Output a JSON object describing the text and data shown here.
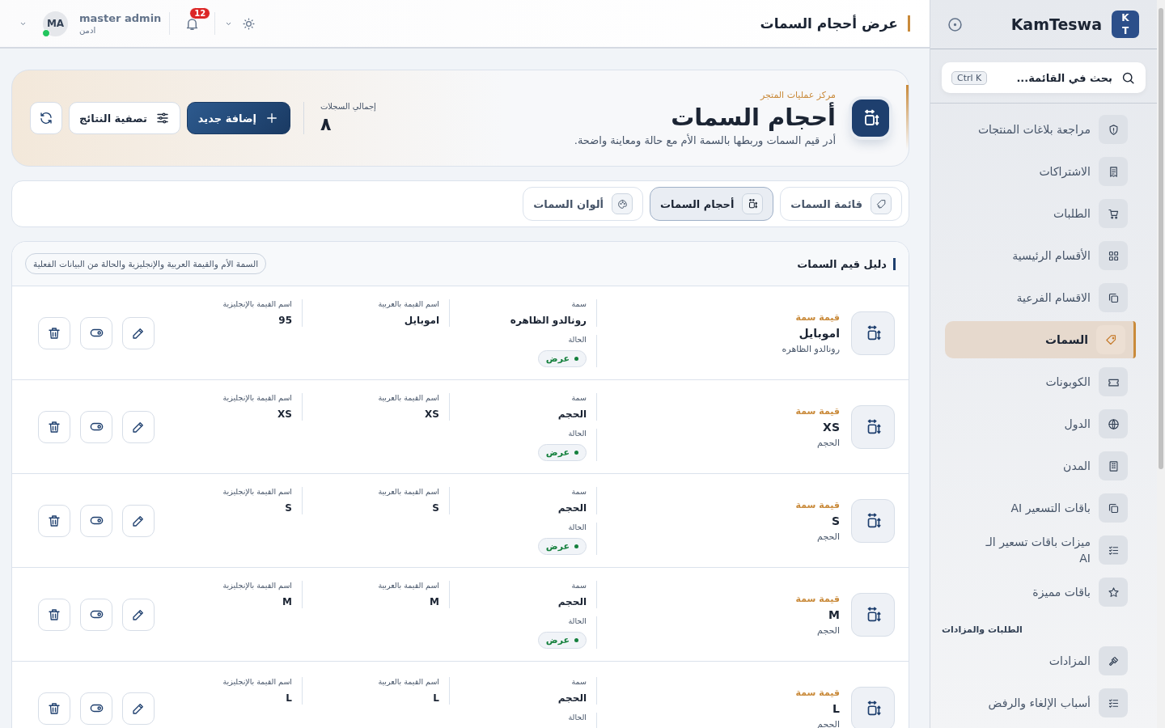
{
  "topbar": {
    "title": "عرض أحجام السمات",
    "notifications": "12",
    "user": {
      "name": "master admin",
      "role": "ادمن",
      "initials": "MA",
      "online": true
    }
  },
  "sidebar": {
    "brand": "KamTeswa",
    "logo": [
      "K",
      "T"
    ],
    "search": {
      "placeholder": "بحث في القائمة...",
      "shortcut": "Ctrl K"
    },
    "items": [
      {
        "kind": "item",
        "label": "مراجعة بلاغات المنتجات",
        "selected": false
      },
      {
        "kind": "item",
        "label": "الاشتراكات",
        "selected": false
      },
      {
        "kind": "item",
        "label": "الطلبات",
        "selected": false
      },
      {
        "kind": "item",
        "label": "الأقسام الرئيسية",
        "selected": false
      },
      {
        "kind": "item",
        "label": "الاقسام الفرعية",
        "selected": false
      },
      {
        "kind": "item",
        "label": "السمات",
        "selected": true
      },
      {
        "kind": "item",
        "label": "الكوبونات",
        "selected": false
      },
      {
        "kind": "item",
        "label": "الدول",
        "selected": false
      },
      {
        "kind": "item",
        "label": "المدن",
        "selected": false
      },
      {
        "kind": "item",
        "label": "باقات التسعير AI",
        "selected": false
      },
      {
        "kind": "item",
        "label": "ميزات باقات تسعير الـ AI",
        "selected": false
      },
      {
        "kind": "item",
        "label": "باقات مميزة",
        "selected": false
      },
      {
        "kind": "section",
        "label": "الطلبات والمزادات"
      },
      {
        "kind": "item",
        "label": "المزادات",
        "selected": false
      },
      {
        "kind": "item",
        "label": "أسباب الإلغاء والرفض",
        "selected": false
      }
    ]
  },
  "hero": {
    "kicker": "مركز عمليات المتجر",
    "title": "أحجام السمات",
    "description": "أدر قيم السمات وربطها بالسمة الأم مع حالة ومعاينة واضحة.",
    "stat_label": "إجمالي السجلات",
    "stat_value": "٨",
    "buttons": [
      {
        "kind": "primary",
        "label": "إضافة جديد"
      },
      {
        "kind": "filter",
        "label": "تصفية النتائج"
      },
      {
        "kind": "refresh"
      }
    ]
  },
  "tabs": [
    {
      "label": "قائمة السمات",
      "selected": false
    },
    {
      "label": "أحجام السمات",
      "selected": true
    },
    {
      "label": "ألوان السمات",
      "selected": false
    }
  ],
  "list": {
    "title": "دليل قيم السمات",
    "hint": "السمة الأم والقيمة العربية والإنجليزية والحالة من البيانات الفعلية",
    "rows": [
      {
        "kicker": "قيمة سمة",
        "title": "اموبايل",
        "subtitle": "رونالدو الظاهره",
        "fields": [
          {
            "label": "سمة",
            "value": "رونالدو الظاهره"
          },
          {
            "label": "اسم القيمة بالعربية",
            "value": "اموبايل"
          },
          {
            "label": "اسم القيمة بالإنجليزية",
            "value": "95"
          }
        ],
        "status_label": "الحالة",
        "status": "عرض"
      },
      {
        "kicker": "قيمة سمة",
        "title": "XS",
        "subtitle": "الحجم",
        "fields": [
          {
            "label": "سمة",
            "value": "الحجم"
          },
          {
            "label": "اسم القيمة بالعربية",
            "value": "XS"
          },
          {
            "label": "اسم القيمة بالإنجليزية",
            "value": "XS"
          }
        ],
        "status_label": "الحالة",
        "status": "عرض"
      },
      {
        "kicker": "قيمة سمة",
        "title": "S",
        "subtitle": "الحجم",
        "fields": [
          {
            "label": "سمة",
            "value": "الحجم"
          },
          {
            "label": "اسم القيمة بالعربية",
            "value": "S"
          },
          {
            "label": "اسم القيمة بالإنجليزية",
            "value": "S"
          }
        ],
        "status_label": "الحالة",
        "status": "عرض"
      },
      {
        "kicker": "قيمة سمة",
        "title": "M",
        "subtitle": "الحجم",
        "fields": [
          {
            "label": "سمة",
            "value": "الحجم"
          },
          {
            "label": "اسم القيمة بالعربية",
            "value": "M"
          },
          {
            "label": "اسم القيمة بالإنجليزية",
            "value": "M"
          }
        ],
        "status_label": "الحالة",
        "status": "عرض"
      },
      {
        "kicker": "قيمة سمة",
        "title": "L",
        "subtitle": "الحجم",
        "fields": [
          {
            "label": "سمة",
            "value": "الحجم"
          },
          {
            "label": "اسم القيمة بالعربية",
            "value": "L"
          },
          {
            "label": "اسم القيمة بالإنجليزية",
            "value": "L"
          }
        ],
        "status_label": "الحالة"
      }
    ]
  }
}
